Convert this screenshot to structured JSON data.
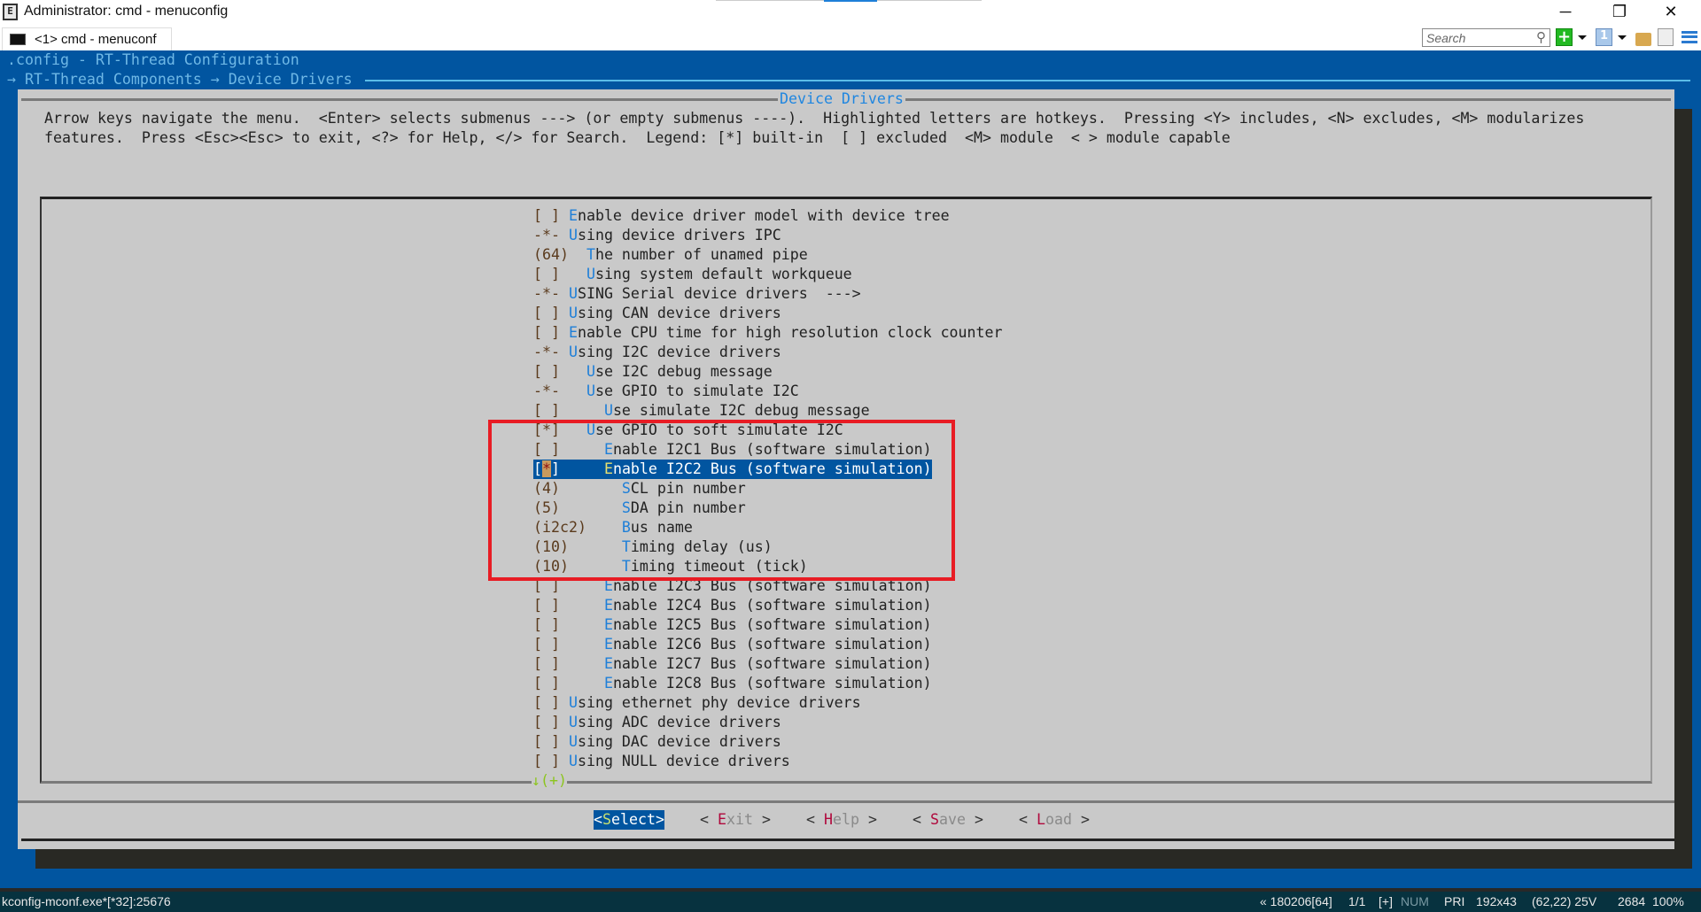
{
  "window": {
    "title": "Administrator: cmd - menuconfig",
    "tab_label": "<1> cmd - menuconf",
    "search_placeholder": "Search"
  },
  "header": {
    "config_line": ".config - RT-Thread Configuration",
    "breadcrumb": "→ RT-Thread Components → Device Drivers"
  },
  "dialog": {
    "title": "Device Drivers",
    "help_lines": [
      "Arrow keys navigate the menu.  <Enter> selects submenus ---> (or empty submenus ----).  Highlighted letters are hotkeys.  Pressing <Y> includes, <N> excludes, <M> modularizes",
      "features.  Press <Esc><Esc> to exit, <?> for Help, </> for Search.  Legend: [*] built-in  [ ] excluded  <M> module  < > module capable"
    ],
    "more_indicator": "↓(+)"
  },
  "menu": {
    "selected_index": 13,
    "items": [
      {
        "prefix": "[ ] ",
        "hot": "E",
        "rest": "nable device driver model with device tree"
      },
      {
        "prefix": "-*- ",
        "hot": "U",
        "rest": "sing device drivers IPC"
      },
      {
        "prefix": "(64)  ",
        "hot": "T",
        "rest": "he number of unamed pipe"
      },
      {
        "prefix": "[ ]   ",
        "hot": "U",
        "rest": "sing system default workqueue"
      },
      {
        "prefix": "-*- ",
        "hot": "U",
        "rest": "SING Serial device drivers  --->"
      },
      {
        "prefix": "[ ] ",
        "hot": "U",
        "rest": "sing CAN device drivers"
      },
      {
        "prefix": "[ ] ",
        "hot": "E",
        "rest": "nable CPU time for high resolution clock counter"
      },
      {
        "prefix": "-*- ",
        "hot": "U",
        "rest": "sing I2C device drivers"
      },
      {
        "prefix": "[ ]   ",
        "hot": "U",
        "rest": "se I2C debug message"
      },
      {
        "prefix": "-*-   ",
        "hot": "U",
        "rest": "se GPIO to simulate I2C"
      },
      {
        "prefix": "[ ]     ",
        "hot": "U",
        "rest": "se simulate I2C debug message"
      },
      {
        "prefix": "[*]   ",
        "hot": "U",
        "rest": "se GPIO to soft simulate I2C"
      },
      {
        "prefix": "[ ]     ",
        "hot": "E",
        "rest": "nable I2C1 Bus (software simulation)"
      },
      {
        "prefix": "[*]     ",
        "hot": "E",
        "rest": "nable I2C2 Bus (software simulation)"
      },
      {
        "prefix": "(4)       ",
        "hot": "S",
        "rest": "CL pin number"
      },
      {
        "prefix": "(5)       ",
        "hot": "S",
        "rest": "DA pin number"
      },
      {
        "prefix": "(i2c2)    ",
        "hot": "B",
        "rest": "us name"
      },
      {
        "prefix": "(10)      ",
        "hot": "T",
        "rest": "iming delay (us)"
      },
      {
        "prefix": "(10)      ",
        "hot": "T",
        "rest": "iming timeout (tick)"
      },
      {
        "prefix": "[ ]     ",
        "hot": "E",
        "rest": "nable I2C3 Bus (software simulation)"
      },
      {
        "prefix": "[ ]     ",
        "hot": "E",
        "rest": "nable I2C4 Bus (software simulation)"
      },
      {
        "prefix": "[ ]     ",
        "hot": "E",
        "rest": "nable I2C5 Bus (software simulation)"
      },
      {
        "prefix": "[ ]     ",
        "hot": "E",
        "rest": "nable I2C6 Bus (software simulation)"
      },
      {
        "prefix": "[ ]     ",
        "hot": "E",
        "rest": "nable I2C7 Bus (software simulation)"
      },
      {
        "prefix": "[ ]     ",
        "hot": "E",
        "rest": "nable I2C8 Bus (software simulation)"
      },
      {
        "prefix": "[ ] ",
        "hot": "U",
        "rest": "sing ethernet phy device drivers"
      },
      {
        "prefix": "[ ] ",
        "hot": "U",
        "rest": "sing ADC device drivers"
      },
      {
        "prefix": "[ ] ",
        "hot": "U",
        "rest": "sing DAC device drivers"
      },
      {
        "prefix": "[ ] ",
        "hot": "U",
        "rest": "sing NULL device drivers"
      }
    ]
  },
  "buttons": [
    {
      "pre": "<",
      "hot": "S",
      "rest": "elect",
      "post": ">",
      "selected": true
    },
    {
      "pre": "< ",
      "hot": "E",
      "rest": "xit",
      "post": " >"
    },
    {
      "pre": "< ",
      "hot": "H",
      "rest": "elp",
      "post": " >"
    },
    {
      "pre": "< ",
      "hot": "S",
      "rest": "ave",
      "post": " >"
    },
    {
      "pre": "< ",
      "hot": "L",
      "rest": "oad",
      "post": " >"
    }
  ],
  "status": {
    "process": "kconfig-mconf.exe*[*32]:25676",
    "build": "« 180206[64]",
    "pages": "1/1",
    "plus": "[+]",
    "num": "NUM",
    "pri": "PRI",
    "size": "192x43",
    "pos": "(62,22) 25V",
    "pid": "2684",
    "zoom": "100%"
  },
  "colors": {
    "terminal_blue": "#0155a0",
    "dialog_gray": "#c9c9c9",
    "hotkey": "#1e7fd8",
    "annotation_red": "#e81c24"
  }
}
